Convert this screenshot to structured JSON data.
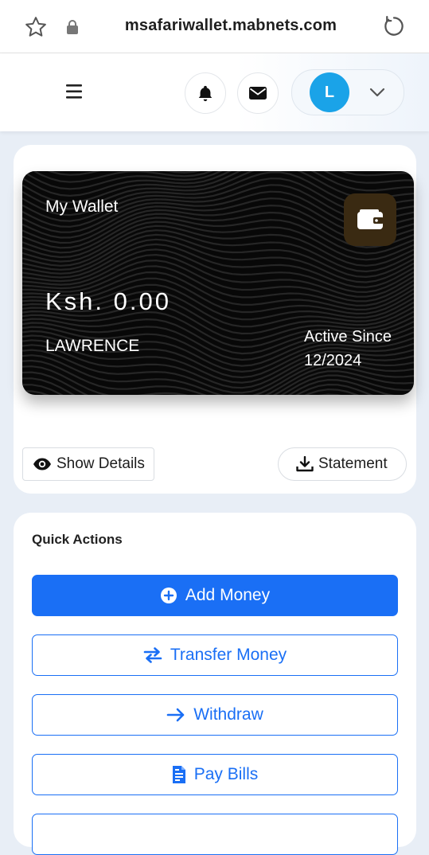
{
  "browser": {
    "url": "msafariwallet.mabnets.com"
  },
  "header": {
    "menu_icon": "hamburger-icon",
    "notifications_icon": "bell-icon",
    "messages_icon": "envelope-icon",
    "avatar_initial": "L",
    "profile_dropdown_icon": "chevron-down-icon"
  },
  "wallet": {
    "title": "My Wallet",
    "balance": "Ksh. 0.00",
    "holder": "LAWRENCE",
    "active_since_label": "Active Since",
    "active_since_date": "12/2024",
    "show_details_label": "Show Details",
    "statement_label": "Statement"
  },
  "quick_actions": {
    "title": "Quick Actions",
    "items": [
      {
        "label": "Add Money",
        "icon": "plus-circle-icon"
      },
      {
        "label": "Transfer Money",
        "icon": "exchange-arrows-icon"
      },
      {
        "label": "Withdraw",
        "icon": "arrow-right-icon"
      },
      {
        "label": "Pay Bills",
        "icon": "invoice-icon"
      }
    ]
  },
  "colors": {
    "primary": "#1a6ff5",
    "avatar": "#1aa3e8",
    "card": "#080808"
  }
}
